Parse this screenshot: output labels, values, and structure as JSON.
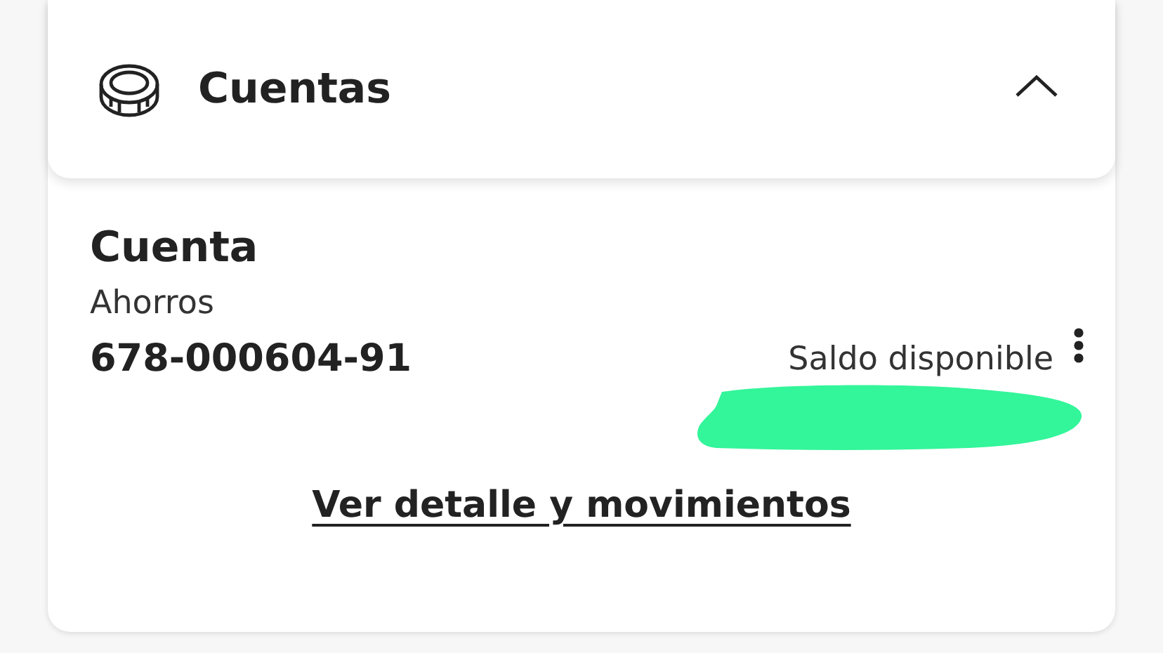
{
  "section": {
    "title": "Cuentas",
    "expanded": true
  },
  "account": {
    "title": "Cuenta",
    "type": "Ahorros",
    "number": "678-000604-91",
    "balance_label": "Saldo disponible",
    "redacted": true
  },
  "link": "Ver detalle y movimientos"
}
